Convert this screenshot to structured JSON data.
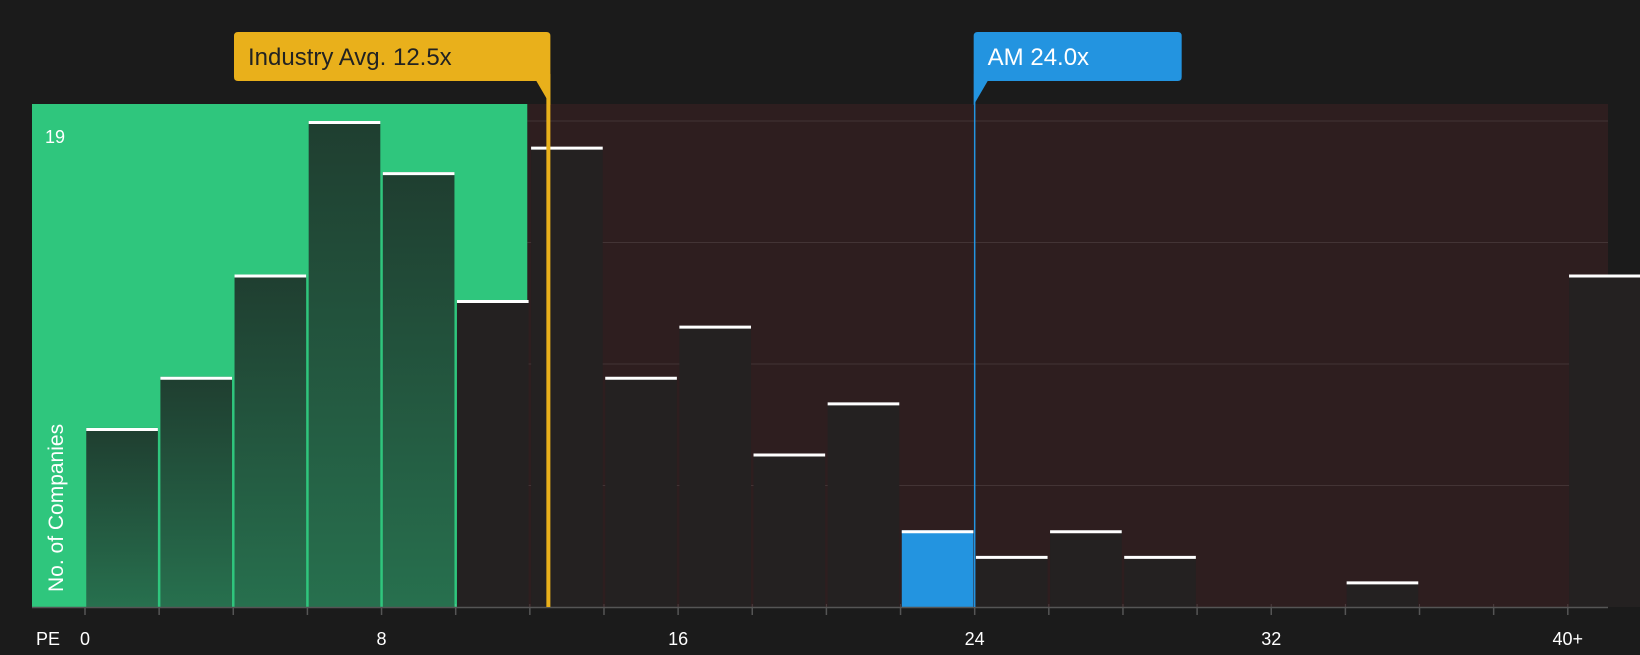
{
  "chart_data": {
    "type": "bar",
    "title": "",
    "xlabel": "PE",
    "ylabel": "No. of Companies",
    "y_max_label": "19",
    "ylim": [
      0,
      19.7
    ],
    "x_ticks": [
      "0",
      "8",
      "16",
      "24",
      "32",
      "40+"
    ],
    "x_tick_values": [
      0,
      8,
      16,
      24,
      32,
      40
    ],
    "bin_width": 2,
    "bins": [
      {
        "start": 0,
        "count": 7
      },
      {
        "start": 2,
        "count": 9
      },
      {
        "start": 4,
        "count": 13
      },
      {
        "start": 6,
        "count": 19
      },
      {
        "start": 8,
        "count": 17
      },
      {
        "start": 10,
        "count": 12
      },
      {
        "start": 12,
        "count": 18
      },
      {
        "start": 14,
        "count": 9
      },
      {
        "start": 16,
        "count": 11
      },
      {
        "start": 18,
        "count": 6
      },
      {
        "start": 20,
        "count": 8
      },
      {
        "start": 22,
        "count": 3,
        "highlight": true
      },
      {
        "start": 24,
        "count": 2
      },
      {
        "start": 26,
        "count": 3
      },
      {
        "start": 28,
        "count": 2
      },
      {
        "start": 30,
        "count": 0
      },
      {
        "start": 32,
        "count": 0
      },
      {
        "start": 34,
        "count": 1
      },
      {
        "start": 36,
        "count": 0
      },
      {
        "start": 38,
        "count": 0
      },
      {
        "start": 40,
        "count": 13
      }
    ],
    "markers": [
      {
        "label": "Industry Avg. 12.5x",
        "value": 12.5,
        "color": "#e9b01b"
      },
      {
        "label": "AM 24.0x",
        "value": 24.0,
        "color": "#2394e0"
      }
    ],
    "colors": {
      "background": "#1b1b1b",
      "undervalued_zone": "#2fc67d",
      "overvalued_zone": "#2e1e1f",
      "bar_dark": "#242121",
      "highlight_bar": "#2394e0",
      "cap_line": "#ffffff"
    }
  }
}
